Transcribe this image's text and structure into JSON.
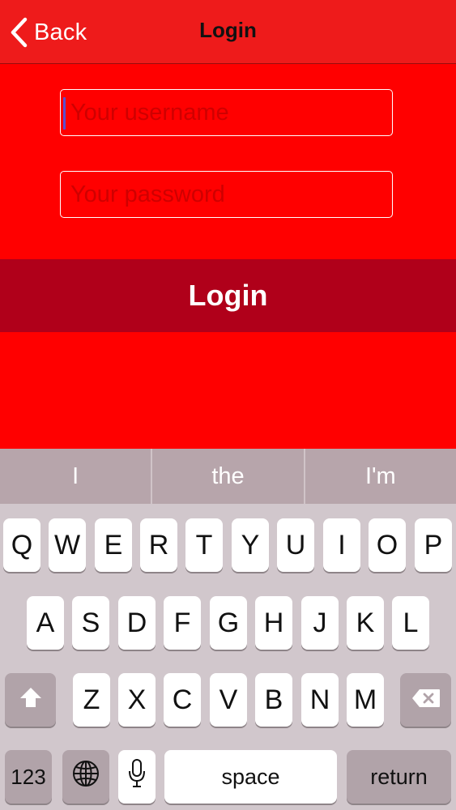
{
  "nav": {
    "back_label": "Back",
    "title": "Login"
  },
  "form": {
    "username_placeholder": "Your username",
    "username_value": "",
    "password_placeholder": "Your password",
    "password_value": "",
    "login_button_label": "Login"
  },
  "keyboard": {
    "suggestions": [
      "I",
      "the",
      "I'm"
    ],
    "row1": [
      "Q",
      "W",
      "E",
      "R",
      "T",
      "Y",
      "U",
      "I",
      "O",
      "P"
    ],
    "row2": [
      "A",
      "S",
      "D",
      "F",
      "G",
      "H",
      "J",
      "K",
      "L"
    ],
    "row3": [
      "Z",
      "X",
      "C",
      "V",
      "B",
      "N",
      "M"
    ],
    "numbers_label": "123",
    "space_label": "space",
    "return_label": "return",
    "icons": [
      "shift-icon",
      "backspace-icon",
      "globe-icon",
      "microphone-icon",
      "chevron-left-icon"
    ]
  },
  "colors": {
    "background": "#ff0000",
    "navbar": "#ee1b1b",
    "login_button": "#b0001a",
    "keyboard": "#d1c7cc",
    "suggestion_bar": "#b7a5ab"
  }
}
